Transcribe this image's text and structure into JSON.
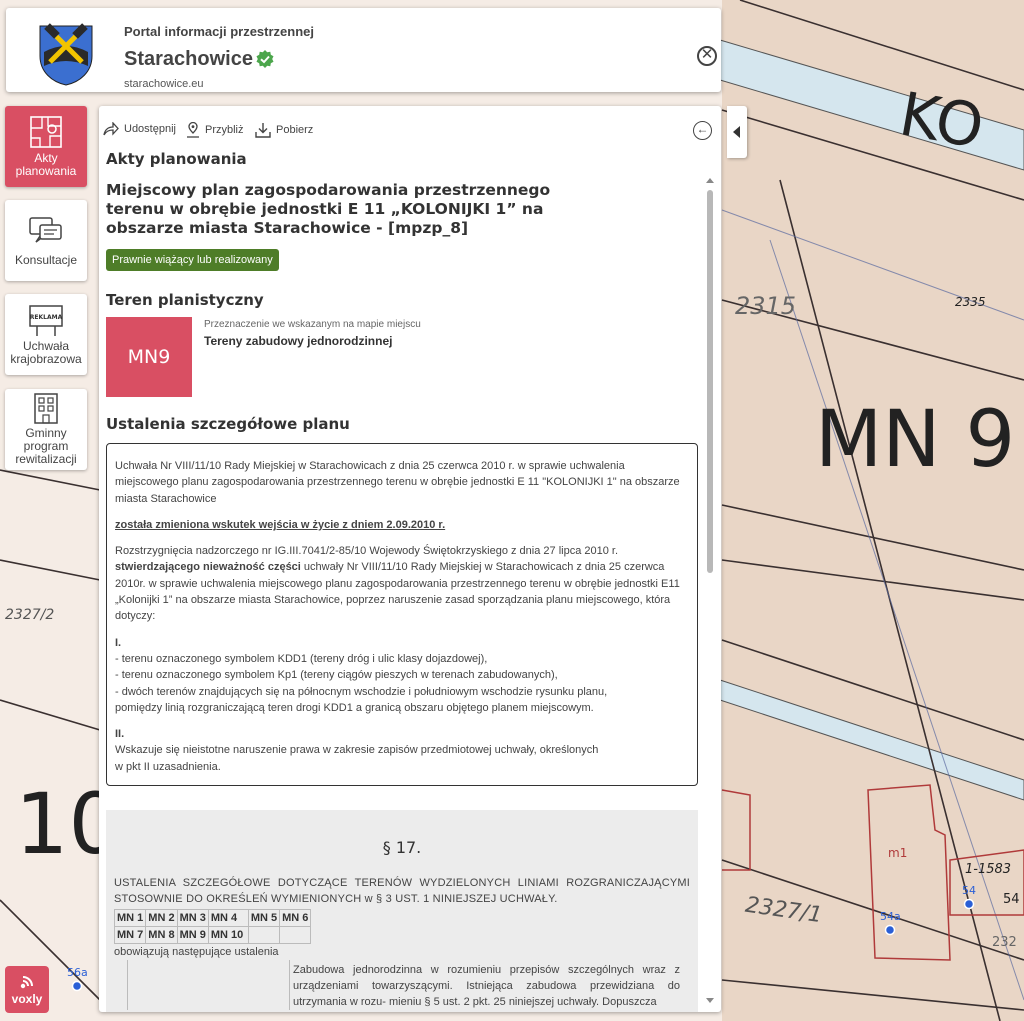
{
  "header": {
    "portal_name": "Portal informacji przestrzennej",
    "city_name": "Starachowice",
    "url": "starachowice.eu",
    "close_label": "✕"
  },
  "nav": {
    "items": [
      {
        "label": "Akty planowania",
        "active": true
      },
      {
        "label": "Konsultacje"
      },
      {
        "label": "Uchwała krajobrazowa",
        "sign_text": "REKLAMA"
      },
      {
        "label": "Gminny program rewitalizacji"
      }
    ]
  },
  "voxly": {
    "label": "voxly"
  },
  "toolbar": {
    "share": "Udostępnij",
    "zoom": "Przybliż",
    "download": "Pobierz"
  },
  "panel": {
    "section_title": "Akty planowania",
    "plan_title": "Miejscowy plan zagospodarowania przestrzennego terenu w obrębie jednostki E 11 „KOLONIJKI 1” na obszarze miasta Starachowice - [mpzp_8]",
    "status": "Prawnie wiążący lub realizowany",
    "zone_section": "Teren planistyczny",
    "zone_code": "MN9",
    "zone_caption": "Przeznaczenie we wskazanym na mapie miejscu",
    "zone_purpose": "Tereny zabudowy jednorodzinnej",
    "details_title": "Ustalenia szczegółowe planu"
  },
  "text_box": {
    "p1": "Uchwała Nr VIII/11/10 Rady Miejskiej w Starachowicach z dnia 25 czerwca 2010 r. w sprawie uchwalenia miejscowego planu zagospodarowania przestrzennego terenu w obrębie jednostki E 11 \"KOLONIJKI 1\" na obszarze miasta Starachowice",
    "p2": "została zmieniona wskutek wejścia w życie z dniem 2.09.2010 r.",
    "p3a": "Rozstrzygnięcia nadzorczego nr IG.III.7041/2-85/10 Wojewody Świętokrzyskiego z dnia 27 lipca 2010 r.",
    "p3b": "stwierdzającego nieważność części",
    "p3c": " uchwały Nr VIII/11/10 Rady Miejskiej w Starachowicach z dnia 25 czerwca 2010r. w sprawie uchwalenia miejscowego planu zagospodarowania przestrzennego terenu w obrębie jednostki E11 „Kolonijki 1” na obszarze miasta Starachowice, poprzez naruszenie zasad sporządzania planu miejscowego, która dotyczy:",
    "s1": "I.",
    "s1_l1": "- terenu oznaczonego symbolem KDD1 (tereny dróg i ulic klasy dojazdowej),",
    "s1_l2": "- terenu oznaczonego symbolem Kp1 (tereny ciągów pieszych w terenach zabudowanych),",
    "s1_l3": "- dwóch terenów znajdujących się na północnym wschodzie i południowym wschodzie rysunku planu,",
    "s1_l4": "pomiędzy linią rozgraniczającą teren drogi KDD1 a granicą obszaru objętego planem miejscowym.",
    "s2": "II.",
    "s2_l1": "Wskazuje się nieistotne naruszenie prawa w zakresie zapisów przedmiotowej uchwały, określonych",
    "s2_l2": "w pkt II uzasadnienia."
  },
  "doc": {
    "paragraph": "§ 17.",
    "intro": "USTALENIA SZCZEGÓŁOWE DOTYCZĄCE TERENÓW WYDZIELONYCH LINIAMI ROZGRANICZAJĄCYMI STOSOWNIE DO OKREŚLEŃ WYMIENIONYCH w § 3 UST. 1 NINIEJSZEJ UCHWAŁY.",
    "codes_row1": [
      "MN 1",
      "MN 2",
      "MN 3",
      "MN 4",
      "MN 5",
      "MN 6"
    ],
    "codes_row2": [
      "MN 7",
      "MN 8",
      "MN 9",
      "MN 10",
      "",
      ""
    ],
    "tail": "obowiązują następujące ustalenia",
    "cell_text": "Zabudowa jednorodzinna w rozumieniu przepisów szczególnych wraz z urządzeniami towarzyszącymi. Istniejąca zabudowa przewidziana do utrzymania w rozu- mieniu § 5 ust. 2 pkt. 25 niniejszej uchwały. Dopuszcza"
  },
  "map": {
    "labels": [
      "KO",
      "MN 9",
      "10",
      "2315",
      "2335",
      "2327/1",
      "2327/2",
      "1-1583",
      "m1",
      "54",
      "54a",
      "56a",
      "54",
      "232"
    ],
    "colors": {
      "ground": "#e9d6c6",
      "parcel_line": "#3a3030",
      "boundary": "#b03a3a",
      "road": "#cfe3ec",
      "point": "#2a5fd6"
    }
  }
}
